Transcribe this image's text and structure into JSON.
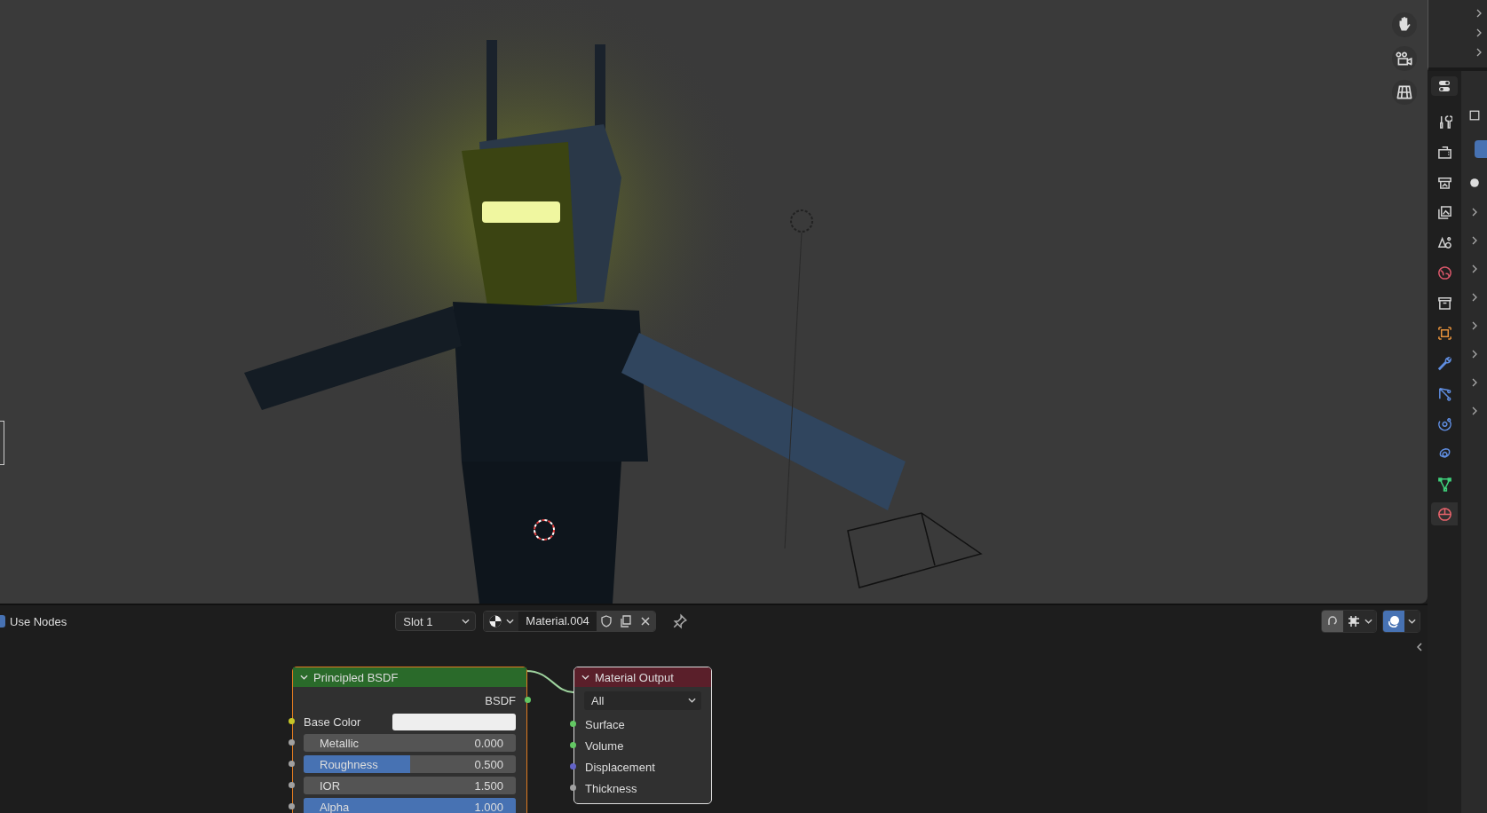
{
  "node_editor": {
    "header": {
      "use_nodes": {
        "label": "Use Nodes",
        "checked": true
      },
      "slot": "Slot 1",
      "material": "Material.004",
      "snapping": true,
      "overlays": true
    },
    "principled": {
      "title": "Principled BSDF",
      "output": "BSDF",
      "inputs": [
        {
          "kind": "color",
          "label": "Base Color",
          "color": "#c7c729"
        },
        {
          "kind": "slider",
          "label": "Metallic",
          "value": "0.000",
          "level": 0,
          "color": "#a1a1a1"
        },
        {
          "kind": "slider",
          "label": "Roughness",
          "value": "0.500",
          "level": 0.5,
          "color": "#a1a1a1"
        },
        {
          "kind": "slider",
          "label": "IOR",
          "value": "1.500",
          "level": 0,
          "color": "#a1a1a1"
        },
        {
          "kind": "slider",
          "label": "Alpha",
          "value": "1.000",
          "level": 1,
          "color": "#a1a1a1"
        }
      ]
    },
    "output": {
      "title": "Material Output",
      "target": "All",
      "inputs": [
        {
          "label": "Surface",
          "color": "#63c763"
        },
        {
          "label": "Volume",
          "color": "#63c763"
        },
        {
          "label": "Displacement",
          "color": "#6363c7"
        },
        {
          "label": "Thickness",
          "color": "#a1a1a1"
        }
      ]
    }
  },
  "properties": {
    "toggle": {
      "on": true
    },
    "tabs": [
      {
        "kind": "tool",
        "selected": false
      },
      {
        "kind": "render",
        "selected": false
      },
      {
        "kind": "output",
        "selected": false
      },
      {
        "kind": "view_layer",
        "selected": false
      },
      {
        "kind": "scene",
        "selected": false
      },
      {
        "kind": "world",
        "selected": false
      },
      {
        "kind": "collection",
        "selected": false
      },
      {
        "kind": "object",
        "selected": false
      },
      {
        "kind": "modifiers",
        "selected": false
      },
      {
        "kind": "particles",
        "selected": false
      },
      {
        "kind": "physics",
        "selected": false
      },
      {
        "kind": "constraints",
        "selected": false
      },
      {
        "kind": "data",
        "selected": false
      },
      {
        "kind": "material",
        "selected": true
      }
    ]
  }
}
